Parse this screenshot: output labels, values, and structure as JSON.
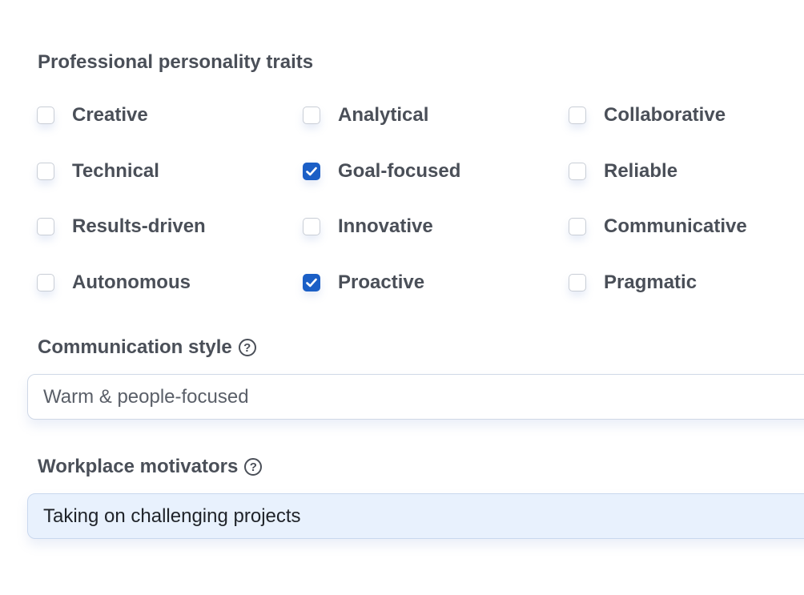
{
  "traits_section": {
    "title": "Professional personality traits",
    "traits": [
      {
        "label": "Creative",
        "checked": false
      },
      {
        "label": "Analytical",
        "checked": false
      },
      {
        "label": "Collaborative",
        "checked": false
      },
      {
        "label": "Technical",
        "checked": false
      },
      {
        "label": "Goal-focused",
        "checked": true
      },
      {
        "label": "Reliable",
        "checked": false
      },
      {
        "label": "Results-driven",
        "checked": false
      },
      {
        "label": "Innovative",
        "checked": false
      },
      {
        "label": "Communicative",
        "checked": false
      },
      {
        "label": "Autonomous",
        "checked": false
      },
      {
        "label": "Proactive",
        "checked": true
      },
      {
        "label": "Pragmatic",
        "checked": false
      }
    ]
  },
  "communication_style": {
    "label": "Communication style",
    "value": "Warm & people-focused"
  },
  "workplace_motivators": {
    "label": "Workplace motivators",
    "value": "Taking on challenging projects"
  },
  "colors": {
    "accent": "#1b5fc6",
    "text": "#4a4f58",
    "selected_field_bg": "#e8f1fd"
  }
}
